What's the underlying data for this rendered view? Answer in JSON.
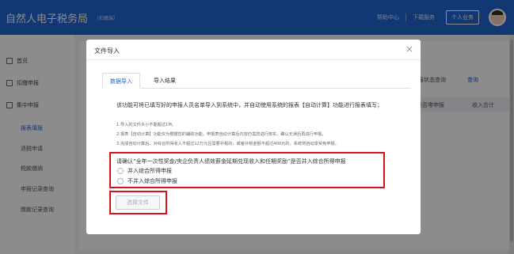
{
  "header": {
    "title": "自然人电子税务局",
    "subtitle": "（扣缴端）",
    "help": "帮助中心",
    "download": "下载服务",
    "personal": "个人业务"
  },
  "sidebar": {
    "items": [
      {
        "label": "首页",
        "icon": "home-icon"
      },
      {
        "label": "扣缴申报",
        "icon": "document-icon"
      },
      {
        "label": "集中申报",
        "icon": "document-icon"
      }
    ],
    "subitems": [
      {
        "label": "报表填报",
        "active": true
      },
      {
        "label": "退税申请",
        "active": false
      },
      {
        "label": "税款缴纳",
        "active": false
      },
      {
        "label": "申报记录查询",
        "active": false
      },
      {
        "label": "缴款记录查询",
        "active": false
      }
    ]
  },
  "background": {
    "status_query": "申报状态查询",
    "query_button": "查询",
    "col_declare": "是否零申报",
    "col_income": "收入合计"
  },
  "modal": {
    "title": "文件导入",
    "tabs": [
      "数据导入",
      "导入结果"
    ],
    "description": "该功能可将已填写好的申报人员名单导入到系统中，并自动使用系统的报表【自动计算】功能进行报表填写；",
    "notes": [
      "1.导入的文件大小不能超过1M。",
      "2.报表【自动计算】功能仅为根据您的辅助功能，申报表自动计算后内容仍需您进行核实，确认无误后再进行申报。",
      "3.完成自动计算后，对综合所得收入不超过12万元且需要补税的，或者补税金额不超过400元的，系统将自动享受免申报。"
    ],
    "confirm_question": "请确认“全年一次性奖金/央企负责人绩效薪金延期兑现收入和任期奖励”是否并入综合所得申报",
    "option_include": "并入综合所得申报",
    "option_exclude": "不并入综合所得申报",
    "select_file": "选择文件"
  },
  "colors": {
    "brand": "#2266d3",
    "highlight": "#d6131d"
  }
}
